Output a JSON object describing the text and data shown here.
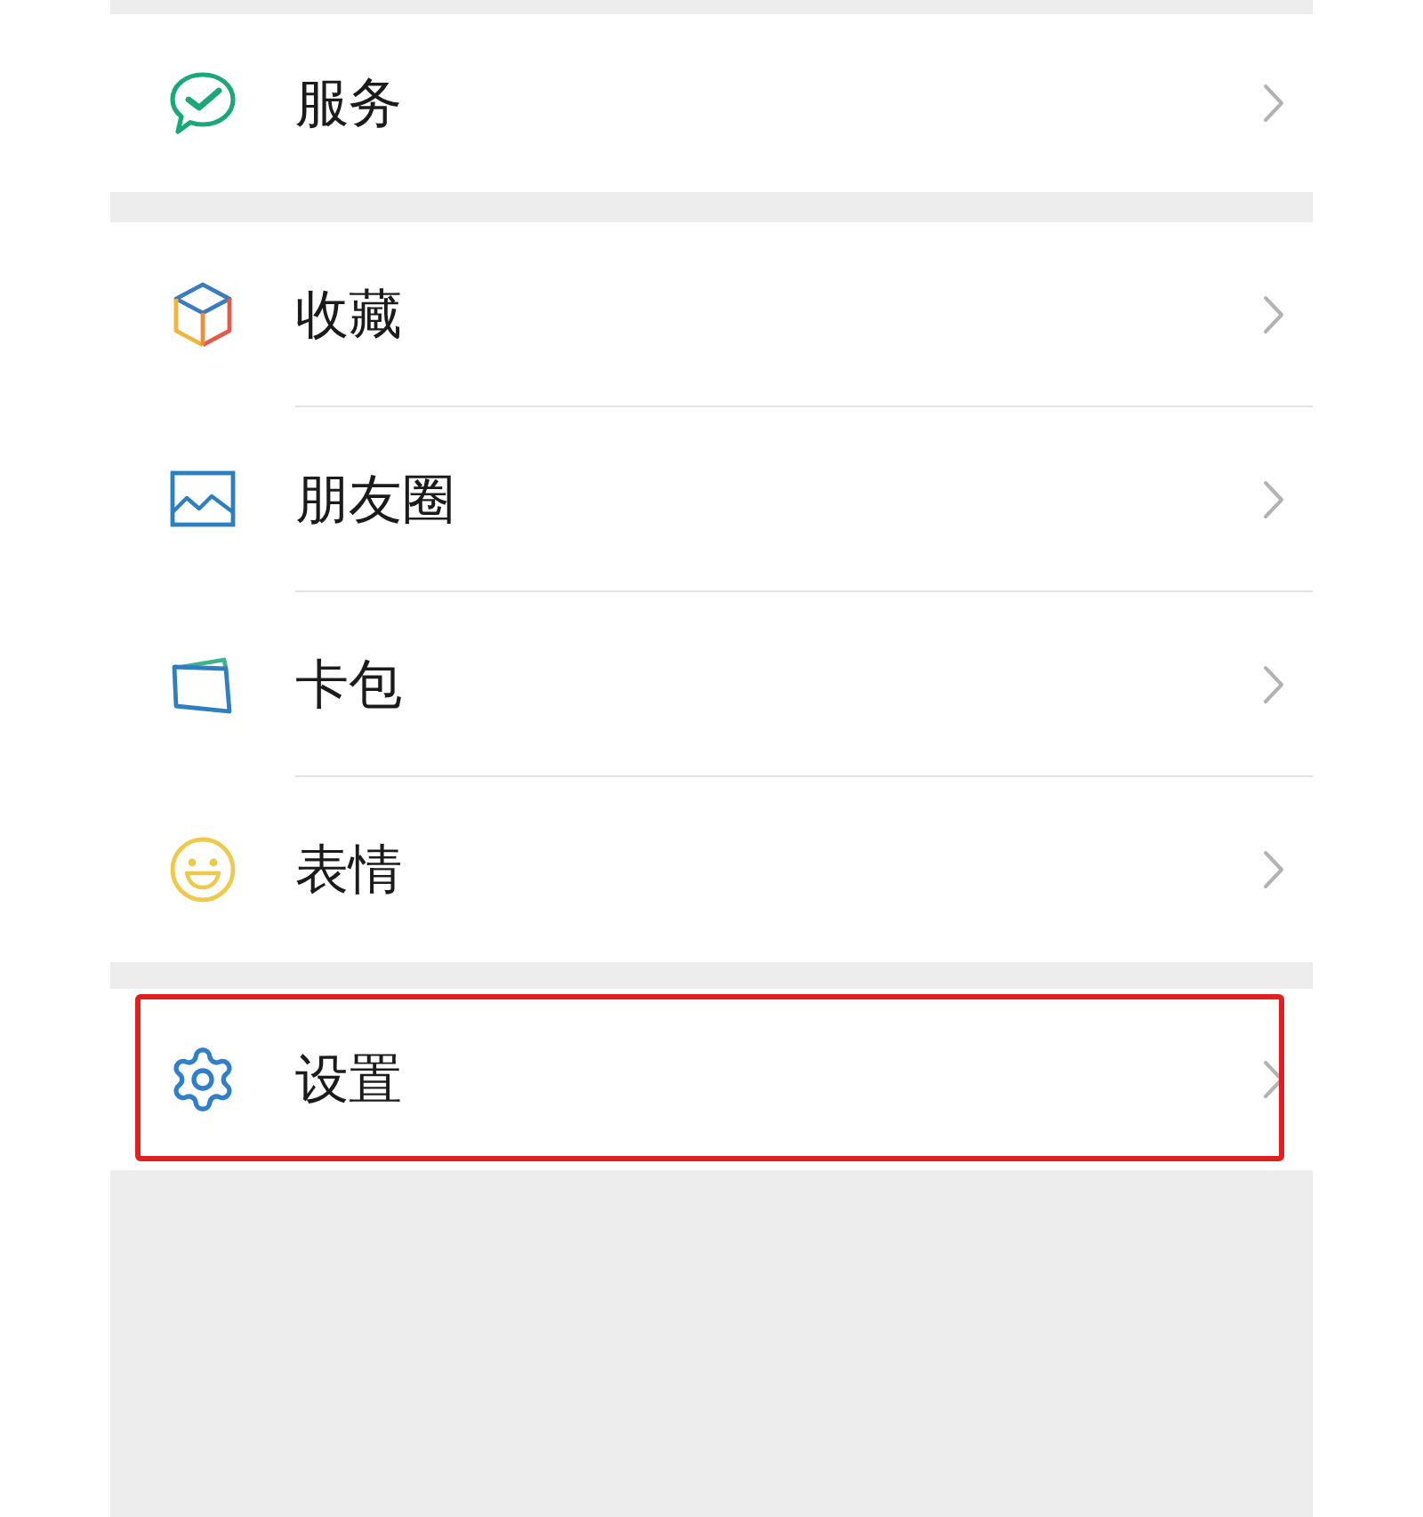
{
  "sections": [
    {
      "items": [
        {
          "kind": "service",
          "label": "服务",
          "highlighted": false
        }
      ]
    },
    {
      "items": [
        {
          "kind": "favorites",
          "label": "收藏",
          "highlighted": false
        },
        {
          "kind": "moments",
          "label": "朋友圈",
          "highlighted": false
        },
        {
          "kind": "cards",
          "label": "卡包",
          "highlighted": false
        },
        {
          "kind": "stickers",
          "label": "表情",
          "highlighted": false
        }
      ]
    },
    {
      "items": [
        {
          "kind": "settings",
          "label": "设置",
          "highlighted": true
        }
      ]
    }
  ]
}
